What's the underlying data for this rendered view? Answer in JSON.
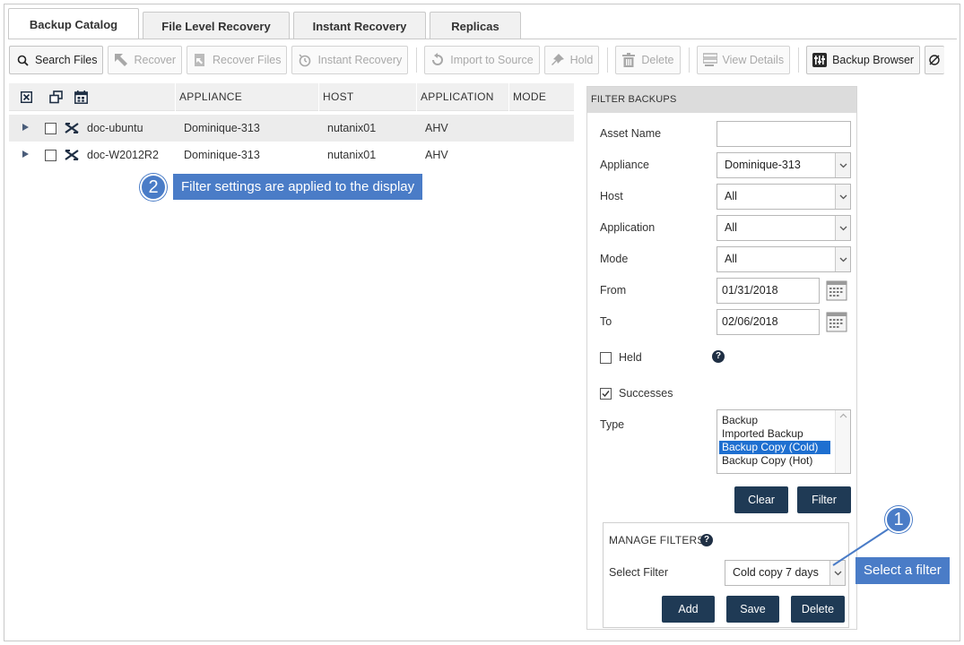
{
  "tabs": [
    {
      "label": "Backup Catalog",
      "active": true
    },
    {
      "label": "File Level Recovery",
      "active": false
    },
    {
      "label": "Instant Recovery",
      "active": false
    },
    {
      "label": "Replicas",
      "active": false
    }
  ],
  "toolbar": {
    "search_files": "Search Files",
    "recover": "Recover",
    "recover_files": "Recover Files",
    "instant_recovery": "Instant Recovery",
    "import_to_source": "Import to Source",
    "hold": "Hold",
    "delete": "Delete",
    "view_details": "View Details",
    "backup_browser": "Backup Browser"
  },
  "table": {
    "columns": [
      "APPLIANCE",
      "HOST",
      "APPLICATION",
      "MODE"
    ],
    "rows": [
      {
        "name": "doc-ubuntu",
        "appliance": "Dominique-313",
        "host": "nutanix01",
        "application": "AHV",
        "mode": ""
      },
      {
        "name": "doc-W2012R2",
        "appliance": "Dominique-313",
        "host": "nutanix01",
        "application": "AHV",
        "mode": ""
      }
    ]
  },
  "callouts": {
    "step2_number": "2",
    "step2_text": "Filter settings are applied to the display",
    "step1_number": "1",
    "step1_text": "Select a filter"
  },
  "filter": {
    "title": "FILTER BACKUPS",
    "asset_name_label": "Asset Name",
    "asset_name_value": "",
    "appliance_label": "Appliance",
    "appliance_value": "Dominique-313",
    "host_label": "Host",
    "host_value": "All",
    "application_label": "Application",
    "application_value": "All",
    "mode_label": "Mode",
    "mode_value": "All",
    "from_label": "From",
    "from_value": "01/31/2018",
    "to_label": "To",
    "to_value": "02/06/2018",
    "held_label": "Held",
    "held_checked": false,
    "successes_label": "Successes",
    "successes_checked": true,
    "type_label": "Type",
    "type_options": [
      "Backup",
      "Imported Backup",
      "Backup Copy (Cold)",
      "Backup Copy (Hot)"
    ],
    "type_selected": "Backup Copy (Cold)",
    "clear_label": "Clear",
    "filter_label": "Filter"
  },
  "manage_filters": {
    "title": "MANAGE FILTERS",
    "select_label": "Select Filter",
    "select_value": "Cold copy 7 days",
    "add_label": "Add",
    "save_label": "Save",
    "delete_label": "Delete"
  },
  "colors": {
    "callout_blue": "#4a7cc7",
    "dark_button": "#1f3a55",
    "selected_option": "#1e6fd0"
  }
}
